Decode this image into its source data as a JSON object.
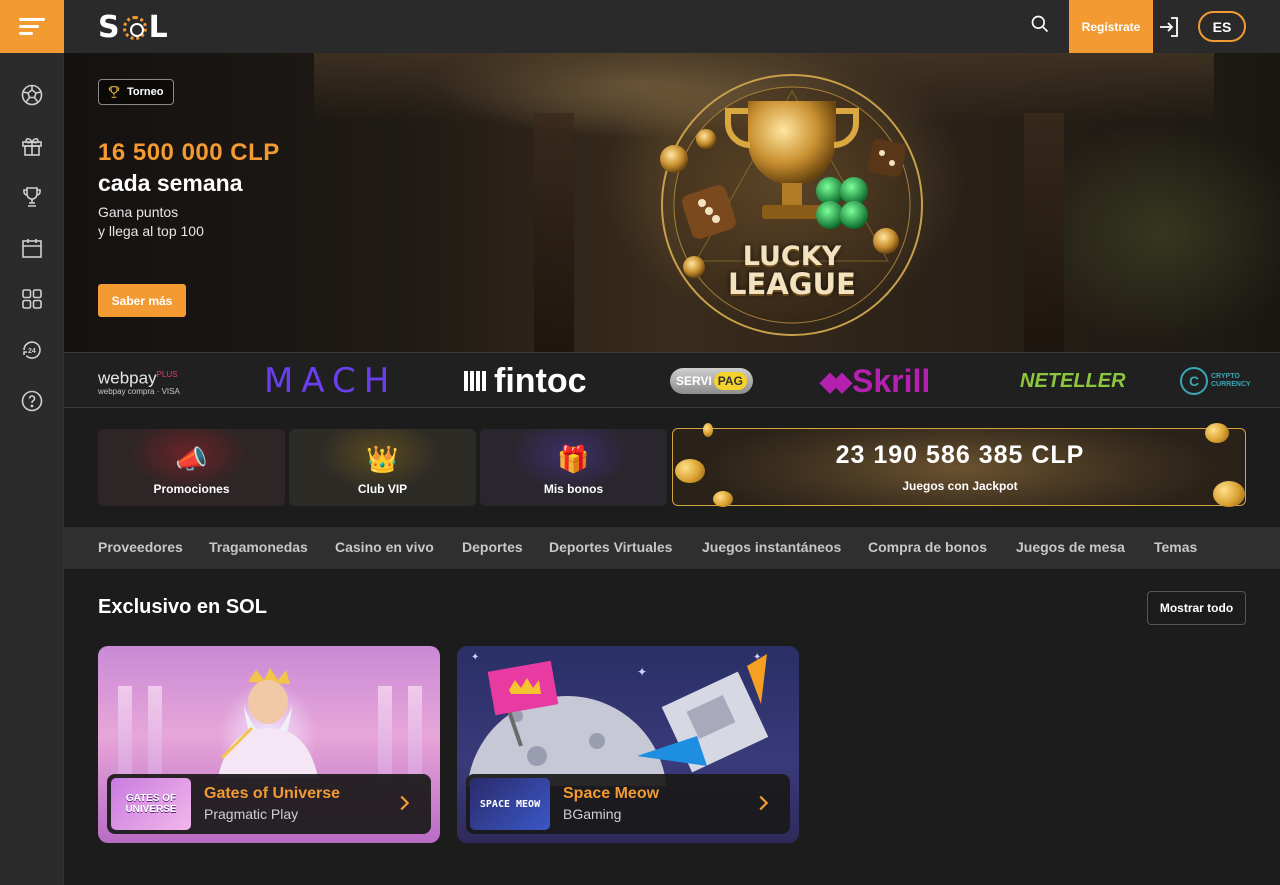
{
  "header": {
    "logo_text": "SOL",
    "register_label": "Regístrate",
    "language": "ES"
  },
  "sidebar": {
    "items": [
      {
        "icon": "soccer-ball-icon"
      },
      {
        "icon": "gift-icon"
      },
      {
        "icon": "trophy-icon"
      },
      {
        "icon": "calendar-icon"
      },
      {
        "icon": "grid-icon"
      },
      {
        "icon": "support-24-icon"
      },
      {
        "icon": "help-icon"
      }
    ]
  },
  "hero": {
    "badge": "Torneo",
    "amount": "16 500 000 CLP",
    "title": "cada semana",
    "desc_line1": "Gana puntos",
    "desc_line2": "y llega al top 100",
    "cta": "Saber más",
    "art_line1": "LUCKY",
    "art_line2": "LEAGUE"
  },
  "payments": {
    "webpay": "webpay",
    "webpay_plus": "PLUS",
    "webpay_sub": "webpay compra · VISA",
    "mach": "MACH",
    "fintoc": "fintoc",
    "servipag_a": "SERVI",
    "servipag_b": "PAG",
    "skrill": "Skrill",
    "neteller": "NETELLER",
    "crypto_mark": "C",
    "crypto_line1": "CRYPTO",
    "crypto_line2": "CURRENCY"
  },
  "tiles": {
    "promociones": "Promociones",
    "club_vip": "Club VIP",
    "mis_bonos": "Mis bonos",
    "jackpot_value": "23 190 586 385 CLP",
    "jackpot_label": "Juegos con Jackpot"
  },
  "categories": [
    "Proveedores",
    "Tragamonedas",
    "Casino en vivo",
    "Deportes",
    "Deportes Virtuales",
    "Juegos instantáneos",
    "Compra de bonos",
    "Juegos de mesa",
    "Temas"
  ],
  "section": {
    "title": "Exclusivo en SOL",
    "show_all": "Mostrar todo"
  },
  "games": [
    {
      "name": "Gates of Universe",
      "provider": "Pragmatic Play",
      "thumb_text": "GATES OF UNIVERSE"
    },
    {
      "name": "Space Meow",
      "provider": "BGaming",
      "thumb_text": "SPACE MEOW"
    }
  ],
  "colors": {
    "accent": "#f39a33",
    "sidebar": "#2b2b2b",
    "background": "#1c1c1c"
  }
}
